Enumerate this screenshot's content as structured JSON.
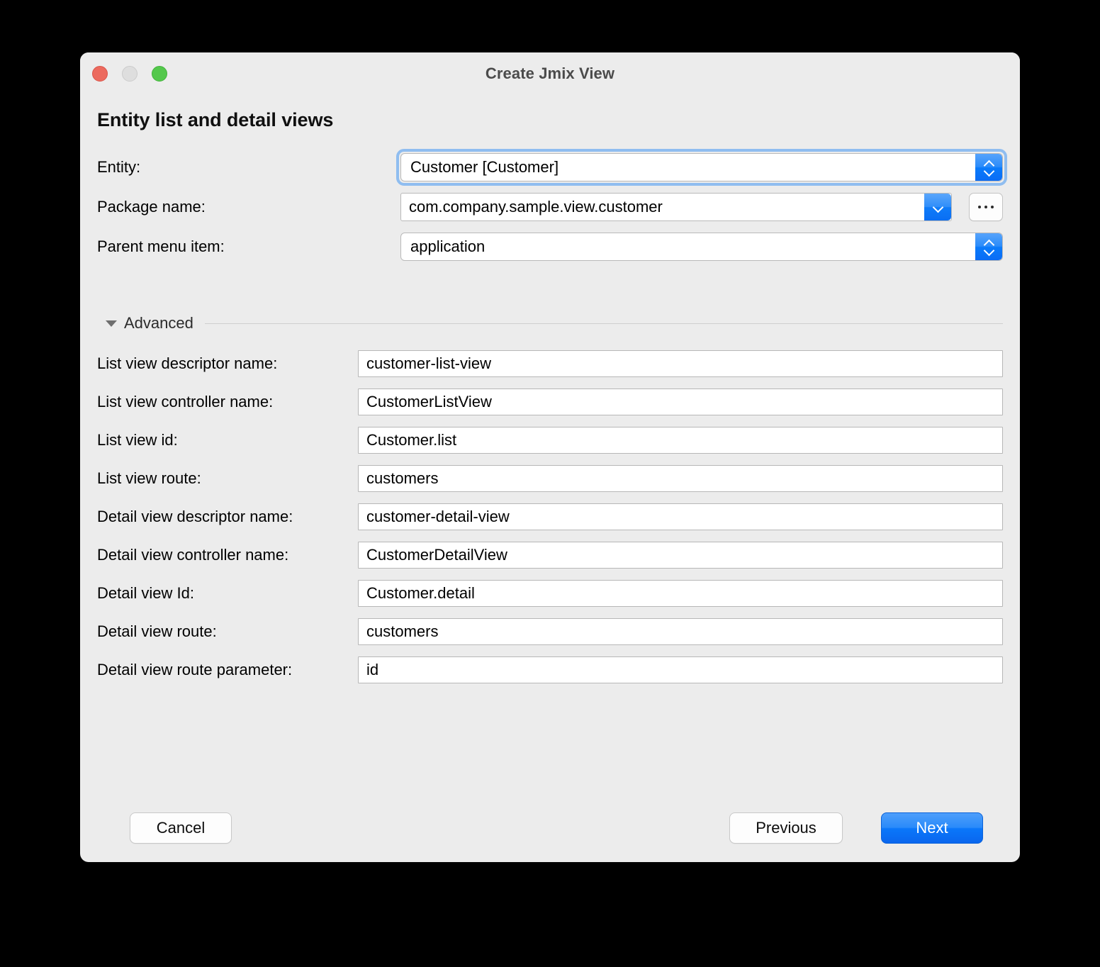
{
  "window": {
    "title": "Create Jmix View",
    "traffic_lights": [
      {
        "name": "close",
        "color": "#ec6a5e"
      },
      {
        "name": "minimize",
        "color": "#dedede"
      },
      {
        "name": "zoom",
        "color": "#54c84c"
      }
    ]
  },
  "heading": "Entity list and detail views",
  "top_fields": [
    {
      "label": "Entity:",
      "value": "Customer [Customer]",
      "control": "popup-button",
      "focused": true
    },
    {
      "label": "Package name:",
      "value": "com.company.sample.view.customer",
      "control": "combo-with-browse",
      "browse_label": "..."
    },
    {
      "label": "Parent menu item:",
      "value": "application",
      "control": "popup-button",
      "focused": false
    }
  ],
  "advanced": {
    "label": "Advanced",
    "expanded": true,
    "fields": [
      {
        "label": "List view descriptor name:",
        "value": "customer-list-view"
      },
      {
        "label": "List view controller name:",
        "value": "CustomerListView"
      },
      {
        "label": "List view id:",
        "value": "Customer.list"
      },
      {
        "label": "List view route:",
        "value": "customers"
      },
      {
        "label": "Detail view descriptor name:",
        "value": "customer-detail-view"
      },
      {
        "label": "Detail view controller name:",
        "value": "CustomerDetailView"
      },
      {
        "label": "Detail view Id:",
        "value": "Customer.detail"
      },
      {
        "label": "Detail view route:",
        "value": "customers"
      },
      {
        "label": "Detail view route parameter:",
        "value": "id"
      }
    ]
  },
  "footer": {
    "cancel_label": "Cancel",
    "previous_label": "Previous",
    "next_label": "Next"
  },
  "colors": {
    "window_background": "#ececec",
    "accent_blue": "#0a77fa",
    "focus_ring": "#8fbdf0",
    "field_border": "#b7b7b7",
    "title_text": "#4b4b4b"
  }
}
